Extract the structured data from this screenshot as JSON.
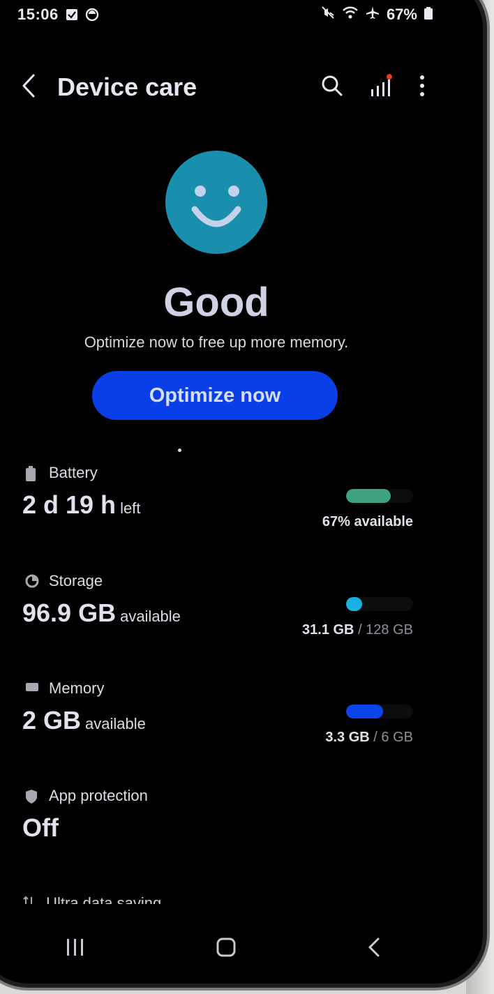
{
  "status_bar": {
    "time": "15:06",
    "battery_percent": "67%",
    "icons": [
      "checkbox-icon",
      "circle-app-icon",
      "mute-icon",
      "wifi-icon",
      "airplane-icon",
      "battery-icon"
    ]
  },
  "app_bar": {
    "title": "Device care",
    "icons": [
      "back-icon",
      "search-icon",
      "signal-icon",
      "more-icon"
    ]
  },
  "status": {
    "label": "Good",
    "message": "Optimize now to free up more memory.",
    "face_color": "#1a8fad"
  },
  "optimize_button": {
    "label": "Optimize now",
    "color": "#0a3ee6"
  },
  "items": {
    "battery": {
      "label": "Battery",
      "value": "2 d 19 h",
      "unit": "left",
      "status": "67% available",
      "level": 0.67,
      "color": "#3ea37f"
    },
    "storage": {
      "label": "Storage",
      "value": "96.9 GB",
      "unit": "available",
      "used": "31.1 GB",
      "total": "/ 128 GB",
      "level": 0.24,
      "color": "#1bb1e0"
    },
    "memory": {
      "label": "Memory",
      "value": "2 GB",
      "unit": "available",
      "used": "3.3 GB",
      "total": "/ 6 GB",
      "level": 0.55,
      "color": "#0a45ea"
    },
    "app_protection": {
      "label": "App protection",
      "value": "Off"
    },
    "ultra_data_saving": {
      "label": "Ultra data saving"
    }
  },
  "nav_bar": {
    "icons": [
      "recent-apps-icon",
      "home-icon",
      "back-nav-icon"
    ]
  }
}
